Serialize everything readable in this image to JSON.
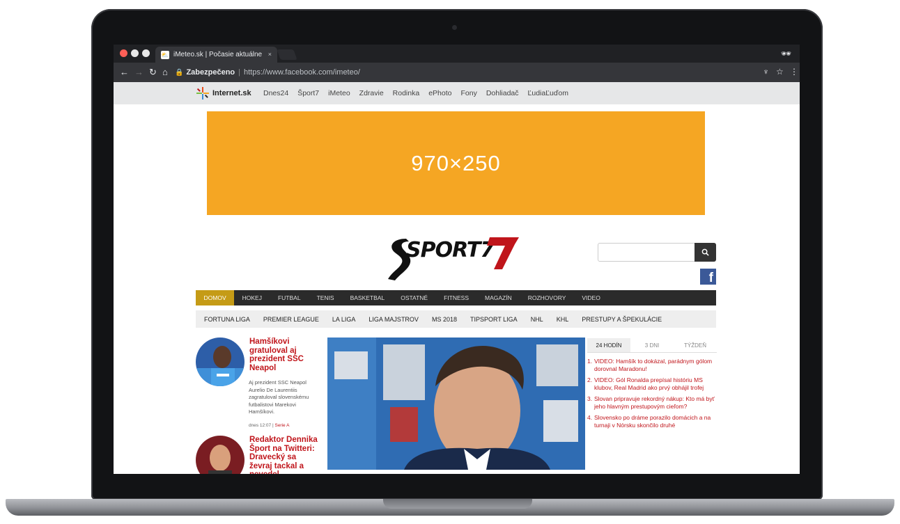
{
  "browser": {
    "tab_title": "iMeteo.sk | Počasie aktuálne",
    "tab_close": "×",
    "security_label": "Zabezpečeno",
    "url": "https://www.facebook.com/imeteo/"
  },
  "portal": {
    "logo_text": "Internet.sk",
    "links": [
      "Dnes24",
      "Šport7",
      "iMeteo",
      "Zdravie",
      "Rodinka",
      "ePhoto",
      "Fony",
      "Dohliadač",
      "ĽudiaĽuďom"
    ]
  },
  "ad": {
    "label": "970×250",
    "color": "#f5a623"
  },
  "site": {
    "logo_text": "SPORT7"
  },
  "search": {
    "placeholder": ""
  },
  "facebook": {
    "label": "f"
  },
  "main_nav": [
    "DOMOV",
    "HOKEJ",
    "FUTBAL",
    "TENIS",
    "BASKETBAL",
    "OSTATNÉ",
    "FITNESS",
    "MAGAZÍN",
    "ROZHOVORY",
    "VIDEO"
  ],
  "sub_nav": [
    "FORTUNA LIGA",
    "PREMIER LEAGUE",
    "LA LIGA",
    "LIGA MAJSTROV",
    "MS 2018",
    "TIPSPORT LIGA",
    "NHL",
    "KHL",
    "PRESTUPY A ŠPEKULÁCIE"
  ],
  "articles": [
    {
      "title": "Hamšíkovi gratuloval aj prezident SSC Neapol",
      "desc": "Aj prezident SSC Neapol Aurelio De Laurentiis zagratuloval slovenskému futbalistovi Marekovi Hamšíkovi.",
      "time": "dnes 12:07",
      "tag": "Serie A"
    },
    {
      "title": "Redaktor Dennika Šport na Twitteri: Dravecký sa ževraj tackal a nevedel",
      "desc": "",
      "time": "",
      "tag": ""
    }
  ],
  "top_tabs": [
    "24 HODÍN",
    "3 DNI",
    "TÝŽDEŇ"
  ],
  "top_list": [
    "VIDEO: Hamšík to dokázal, parádnym gólom dorovnal Maradonu!",
    "VIDEO: Gól Ronalda prepísal históriu MS klubov, Real Madrid ako prvý obhájil trofej",
    "Slovan pripravuje rekordný nákup: Kto má byť jeho hlavným prestupovým cieľom?",
    "Slovensko po dráme porazilo domácich a na turnaji v Nórsku skončilo druhé"
  ],
  "accent_colors": {
    "nav_active": "#c59b16",
    "headline_red": "#c0151b",
    "facebook_blue": "#3b5998"
  }
}
